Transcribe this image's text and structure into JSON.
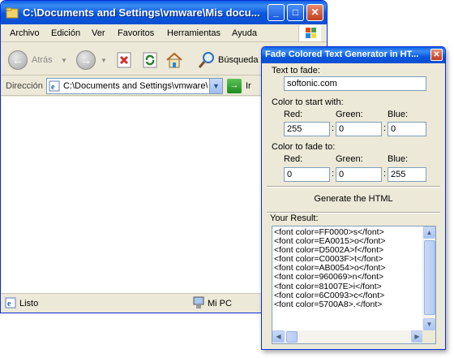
{
  "browser": {
    "title": "C:\\Documents and Settings\\vmware\\Mis docu...",
    "menu": [
      "Archivo",
      "Edición",
      "Ver",
      "Favoritos",
      "Herramientas",
      "Ayuda"
    ],
    "toolbar": {
      "back_label": "Atrás",
      "search_label": "Búsqueda"
    },
    "address": {
      "label": "Dirección",
      "value": "C:\\Documents and Settings\\vmware\\",
      "go_label": "Ir"
    },
    "status": {
      "left": "Listo",
      "zone": "Mi PC"
    }
  },
  "dialog": {
    "title": "Fade Colored Text Generator in HT...",
    "text_label": "Text to fade:",
    "text_value": "softonic.com",
    "start_label": "Color to start with:",
    "end_label": "Color to fade to:",
    "red_label": "Red:",
    "green_label": "Green:",
    "blue_label": "Blue:",
    "start": {
      "red": "255",
      "green": "0",
      "blue": "0"
    },
    "end": {
      "red": "0",
      "green": "0",
      "blue": "255"
    },
    "generate_label": "Generate the HTML",
    "result_label": "Your Result:",
    "result_lines": [
      "<font color=FF0000>s</font>",
      "<font color=EA0015>o</font>",
      "<font color=D5002A>f</font>",
      "<font color=C0003F>t</font>",
      "<font color=AB0054>o</font>",
      "<font color=960069>n</font>",
      "<font color=81007E>i</font>",
      "<font color=6C0093>c</font>",
      "<font color=5700A8>.</font>"
    ]
  }
}
